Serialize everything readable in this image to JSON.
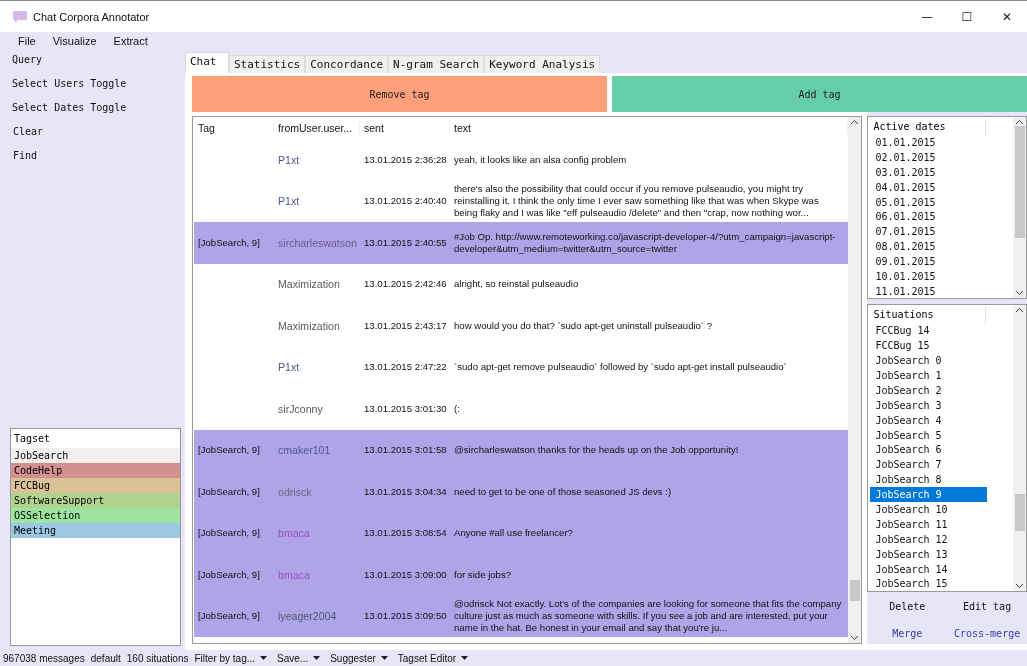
{
  "window": {
    "title": "Chat Corpora Annotator",
    "controls": [
      "—",
      "☐",
      "✕"
    ]
  },
  "menu": [
    "File",
    "Visualize",
    "Extract"
  ],
  "sidebar": {
    "actions": [
      "Query",
      "Select Users Toggle",
      "Select Dates Toggle",
      "Clear",
      "Find"
    ]
  },
  "tagset": {
    "title": "Tagset",
    "items": [
      {
        "label": "JobSearch",
        "color": "#f0f0f0"
      },
      {
        "label": "CodeHelp",
        "color": "#d49090"
      },
      {
        "label": "FCCBug",
        "color": "#dcc096"
      },
      {
        "label": "SoftwareSupport",
        "color": "#b0d490"
      },
      {
        "label": "OSSelection",
        "color": "#9ce4a0"
      },
      {
        "label": "Meeting",
        "color": "#9cc8e4"
      }
    ]
  },
  "tabs": [
    {
      "label": "Chat",
      "selected": true
    },
    {
      "label": "Statistics",
      "selected": false
    },
    {
      "label": "Concordance",
      "selected": false
    },
    {
      "label": "N-gram Search",
      "selected": false
    },
    {
      "label": "Keyword Analysis",
      "selected": false
    }
  ],
  "actions": [
    {
      "label": "Remove tag",
      "kind": "remove"
    },
    {
      "label": "Add tag",
      "kind": "add"
    }
  ],
  "table": {
    "columns": [
      "Tag",
      "fromUser.user...",
      "sent",
      "text"
    ],
    "rows": [
      {
        "tag": "",
        "user": "P1xt",
        "color": "#4a5a8a",
        "sent": "13.01.2015 2:36:28",
        "text": "yeah, it looks like an alsa config problem",
        "tagged": false
      },
      {
        "tag": "",
        "user": "P1xt",
        "color": "#4a5a8a",
        "sent": "13.01.2015 2:40:40",
        "text": "there's also the possibility that could occur if you remove pulseaudio, you might try reinstalling it. I think the only time I ever saw something like that was when Skype was being flaky and I was like  \"eff pulseaudio /delete\" and then \"crap, now nothing wor...",
        "tagged": false
      },
      {
        "tag": "[JobSearch, 9]",
        "user": "sircharleswatson",
        "color": "#6a5a8a",
        "sent": "13.01.2015 2:40:55",
        "text": "#Job Op. http://www.remoteworking.co/javascript-developer-4/?utm_campaign=javascript-developer&utm_medium=twitter&utm_source=twitter",
        "tagged": true
      },
      {
        "tag": "",
        "user": "Maximization",
        "color": "#5a5a5a",
        "sent": "13.01.2015 2:42:46",
        "text": "alright, so reinstal pulseaudio",
        "tagged": false
      },
      {
        "tag": "",
        "user": "Maximization",
        "color": "#5a5a5a",
        "sent": "13.01.2015 2:43:17",
        "text": "how would you do that? `sudo apt-get uninstall pulseaudio` ?",
        "tagged": false
      },
      {
        "tag": "",
        "user": "P1xt",
        "color": "#4a5a8a",
        "sent": "13.01.2015 2:47:22",
        "text": "`sudo apt-get remove pulseaudio` followed by `sudo apt-get install pulseaudio`",
        "tagged": false
      },
      {
        "tag": "",
        "user": "sirJconny",
        "color": "#5a5a5a",
        "sent": "13.01.2015 3:01:30",
        "text": "(:",
        "tagged": false
      },
      {
        "tag": "[JobSearch, 9]",
        "user": "cmaker101",
        "color": "#4a5a8a",
        "sent": "13.01.2015 3:01:58",
        "text": "@sircharleswatson thanks for the heads up on the Job opportunity!",
        "tagged": true
      },
      {
        "tag": "[JobSearch, 9]",
        "user": "odrisck",
        "color": "#6a6a7a",
        "sent": "13.01.2015 3:04:34",
        "text": "need to get to be one of those seasoned JS devs :)",
        "tagged": true
      },
      {
        "tag": "[JobSearch, 9]",
        "user": "bmaca",
        "color": "#9a50c8",
        "sent": "13.01.2015 3:08:54",
        "text": "Anyone #all use freelancer?",
        "tagged": true
      },
      {
        "tag": "[JobSearch, 9]",
        "user": "bmaca",
        "color": "#9a50c8",
        "sent": "13.01.2015 3:09:00",
        "text": "for side jobs?",
        "tagged": true
      },
      {
        "tag": "[JobSearch, 9]",
        "user": "iyeager2004",
        "color": "#4a5a6a",
        "sent": "13.01.2015 3:09:50",
        "text": "@odrisck Not exactly. Lot's of the companies are looking for someone that fits the company culture just as much as someone with skills. If you see a job and are interested, put your name in the hat. Be honest in your email and say that you're ju...",
        "tagged": true
      }
    ]
  },
  "dates": {
    "title": "Active dates",
    "items": [
      "01.01.2015",
      "02.01.2015",
      "03.01.2015",
      "04.01.2015",
      "05.01.2015",
      "06.01.2015",
      "07.01.2015",
      "08.01.2015",
      "09.01.2015",
      "10.01.2015",
      "11.01.2015"
    ]
  },
  "situations": {
    "title": "Situations",
    "items": [
      {
        "label": "FCCBug 14",
        "selected": false
      },
      {
        "label": "FCCBug 15",
        "selected": false
      },
      {
        "label": "JobSearch 0",
        "selected": false
      },
      {
        "label": "JobSearch 1",
        "selected": false
      },
      {
        "label": "JobSearch 2",
        "selected": false
      },
      {
        "label": "JobSearch 3",
        "selected": false
      },
      {
        "label": "JobSearch 4",
        "selected": false
      },
      {
        "label": "JobSearch 5",
        "selected": false
      },
      {
        "label": "JobSearch 6",
        "selected": false
      },
      {
        "label": "JobSearch 7",
        "selected": false
      },
      {
        "label": "JobSearch 8",
        "selected": false
      },
      {
        "label": "JobSearch 9",
        "selected": true
      },
      {
        "label": "JobSearch 10",
        "selected": false
      },
      {
        "label": "JobSearch 11",
        "selected": false
      },
      {
        "label": "JobSearch 12",
        "selected": false
      },
      {
        "label": "JobSearch 13",
        "selected": false
      },
      {
        "label": "JobSearch 14",
        "selected": false
      },
      {
        "label": "JobSearch 15",
        "selected": false
      }
    ]
  },
  "situation_buttons": [
    {
      "label": "Delete",
      "kind": "plain"
    },
    {
      "label": "Edit tag",
      "kind": "plain"
    },
    {
      "label": "Merge",
      "kind": "link"
    },
    {
      "label": "Cross-merge",
      "kind": "link"
    }
  ],
  "status_bar": {
    "texts": [
      "967038 messages",
      "default",
      "160 situations"
    ],
    "menus": [
      "Filter by tag...",
      "Save...",
      "Suggester",
      "Tagset Editor"
    ]
  }
}
